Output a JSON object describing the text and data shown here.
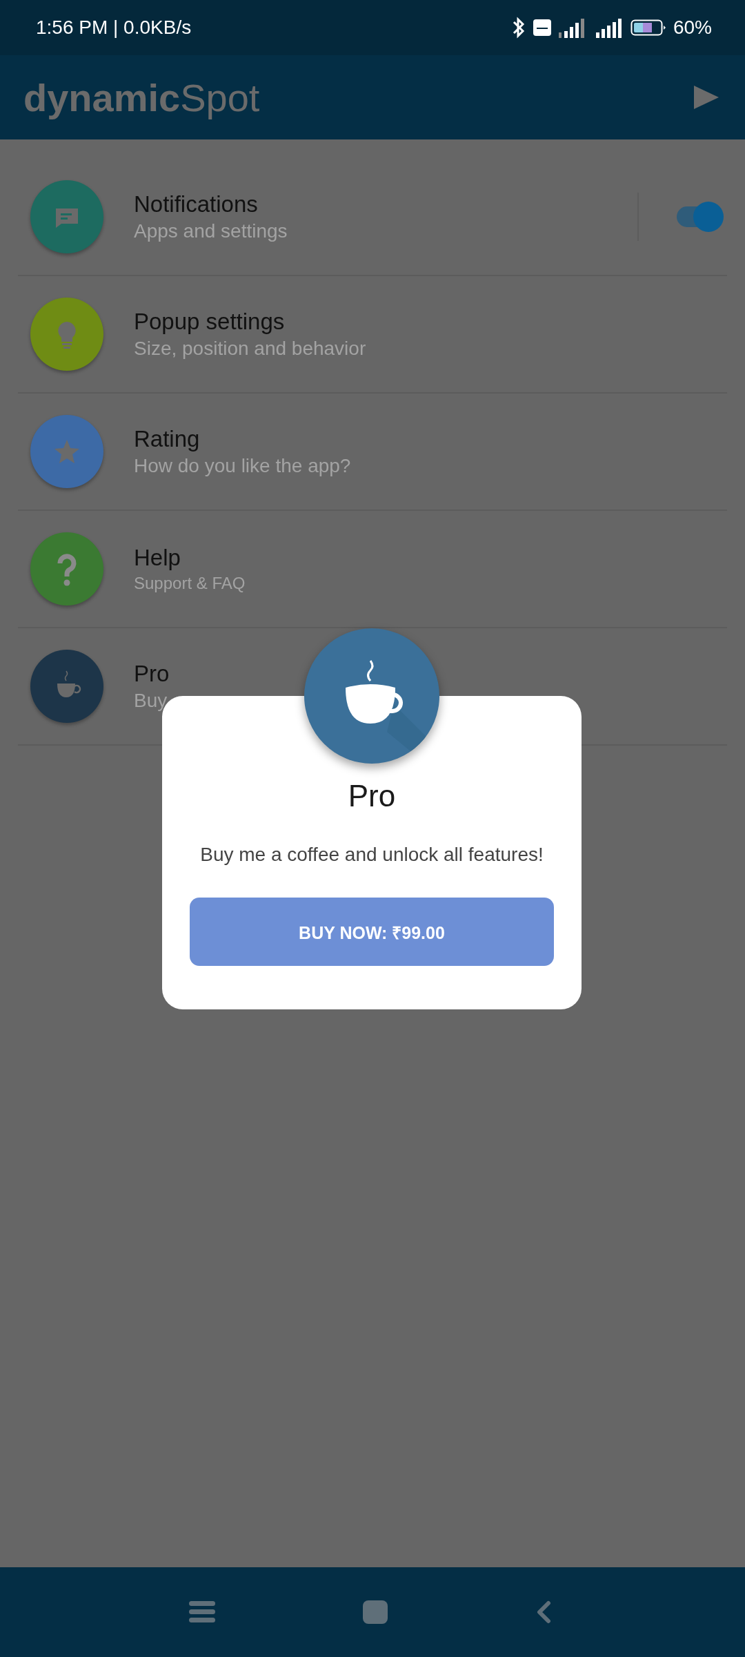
{
  "status_bar": {
    "time": "1:56 PM | 0.0KB/s",
    "battery": "60%"
  },
  "app_bar": {
    "title": "**dynamic**Spot"
  },
  "menu": [
    {
      "title": "Notifications",
      "subtitle": "Apps and settings",
      "toggle": {
        "on": true
      }
    },
    {
      "title": "Popup settings",
      "subtitle": "Size, position and behavior"
    },
    {
      "title": "Rating",
      "subtitle": "How do you like the app?"
    },
    {
      "title": "Help",
      "subtitle": "Support & FAQ",
      "small": true
    },
    {
      "title": "Pro",
      "subtitle": "Buy"
    }
  ],
  "dialog": {
    "title": "Pro",
    "message": "Buy me a coffee and unlock all features!",
    "button": "BUY NOW: ₹99.00"
  }
}
